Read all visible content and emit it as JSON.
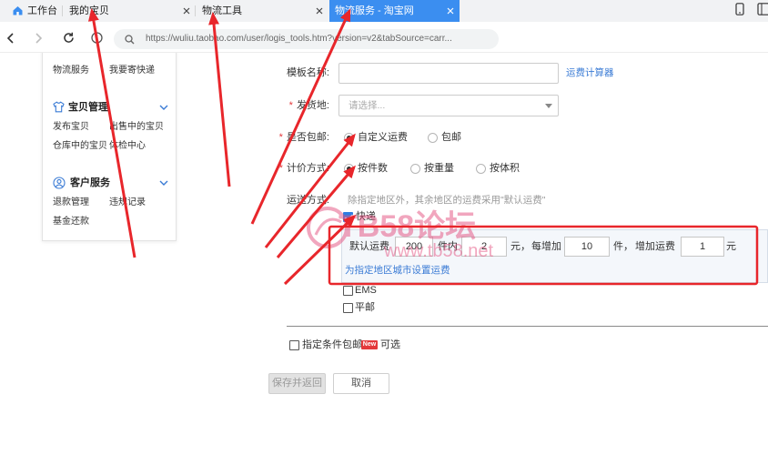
{
  "colors": {
    "tab_active": "#3b8ef0",
    "link": "#3a7bd5",
    "required": "#e4393c",
    "annotation": "#e8262b",
    "watermark": "#e4507f"
  },
  "browser": {
    "tabs": [
      {
        "label": "工作台",
        "icon": "home-icon"
      },
      {
        "label": "我的宝贝",
        "icon": "close-icon"
      },
      {
        "label": "物流工具",
        "icon": "close-icon"
      },
      {
        "label": "物流服务 - 淘宝网",
        "icon": "close-icon",
        "active": true
      }
    ],
    "toolbar_icons": [
      "back-icon",
      "forward-icon",
      "refresh-icon",
      "site-info-icon",
      "search-icon"
    ],
    "url": "https://wuliu.taobao.com/user/logis_tools.htm?version=v2&tabSource=carr...",
    "right_icons": [
      "phone-icon",
      "sidebar-icon"
    ]
  },
  "sidebar": {
    "top_items": [
      "物流服务",
      "我要寄快递"
    ],
    "sections": [
      {
        "title": "宝贝管理",
        "icon": "shirt-icon",
        "items": [
          "发布宝贝",
          "出售中的宝贝",
          "仓库中的宝贝",
          "体检中心"
        ]
      },
      {
        "title": "客户服务",
        "icon": "user-circle-icon",
        "items": [
          "退款管理",
          "违规记录",
          "基金还款"
        ]
      }
    ]
  },
  "form": {
    "required_mark": "*",
    "template_name": {
      "label": "模板名称:",
      "value": "",
      "link": "运费计算器"
    },
    "ship_from": {
      "label": "发货地:",
      "placeholder": "请选择..."
    },
    "free_shipping": {
      "label": "是否包邮:",
      "options": [
        {
          "label": "自定义运费",
          "checked": true
        },
        {
          "label": "包邮",
          "checked": false
        }
      ]
    },
    "pricing": {
      "label": "计价方式:",
      "options": [
        {
          "label": "按件数",
          "checked": true
        },
        {
          "label": "按重量",
          "checked": false
        },
        {
          "label": "按体积",
          "checked": false
        }
      ]
    },
    "delivery": {
      "label": "运送方式:",
      "hint": "除指定地区外，其余地区的运费采用\"默认运费\"",
      "methods": [
        {
          "label": "快递",
          "checked": true
        },
        {
          "label": "EMS",
          "checked": false
        },
        {
          "label": "平邮",
          "checked": false
        }
      ],
      "default_fee": {
        "label": "默认运费",
        "first_qty": "200",
        "first_qty_unit": "件内",
        "first_fee": "2",
        "first_fee_unit": "元，",
        "add_qty_label": "每增加",
        "add_qty": "10",
        "add_qty_unit": "件，",
        "add_fee_label": "增加运费",
        "add_fee": "1",
        "add_fee_unit": "元"
      },
      "region_link": "为指定地区城市设置运费"
    },
    "conditional_free": {
      "label": "指定条件包邮",
      "badge": "New",
      "suffix": "可选",
      "checked": false
    },
    "buttons": {
      "save": "保存并返回",
      "cancel": "取消"
    }
  },
  "watermark": {
    "title": "TB58论坛",
    "site": "www.tb58.net"
  }
}
